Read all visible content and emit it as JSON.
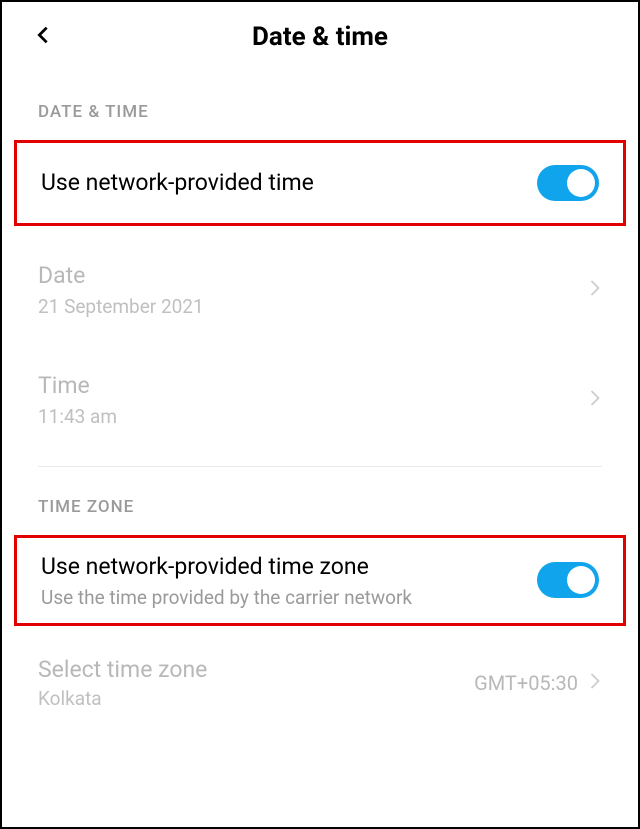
{
  "header": {
    "title": "Date & time"
  },
  "sections": {
    "datetime": {
      "header": "DATE & TIME",
      "network_time": {
        "label": "Use network-provided time",
        "on": true
      },
      "date": {
        "label": "Date",
        "value": "21 September 2021"
      },
      "time": {
        "label": "Time",
        "value": "11:43 am"
      }
    },
    "timezone": {
      "header": "TIME ZONE",
      "network_tz": {
        "label": "Use network-provided time zone",
        "subtitle": "Use the time provided by the carrier network",
        "on": true
      },
      "select_tz": {
        "label": "Select time zone",
        "city": "Kolkata",
        "value": "GMT+05:30"
      }
    }
  }
}
